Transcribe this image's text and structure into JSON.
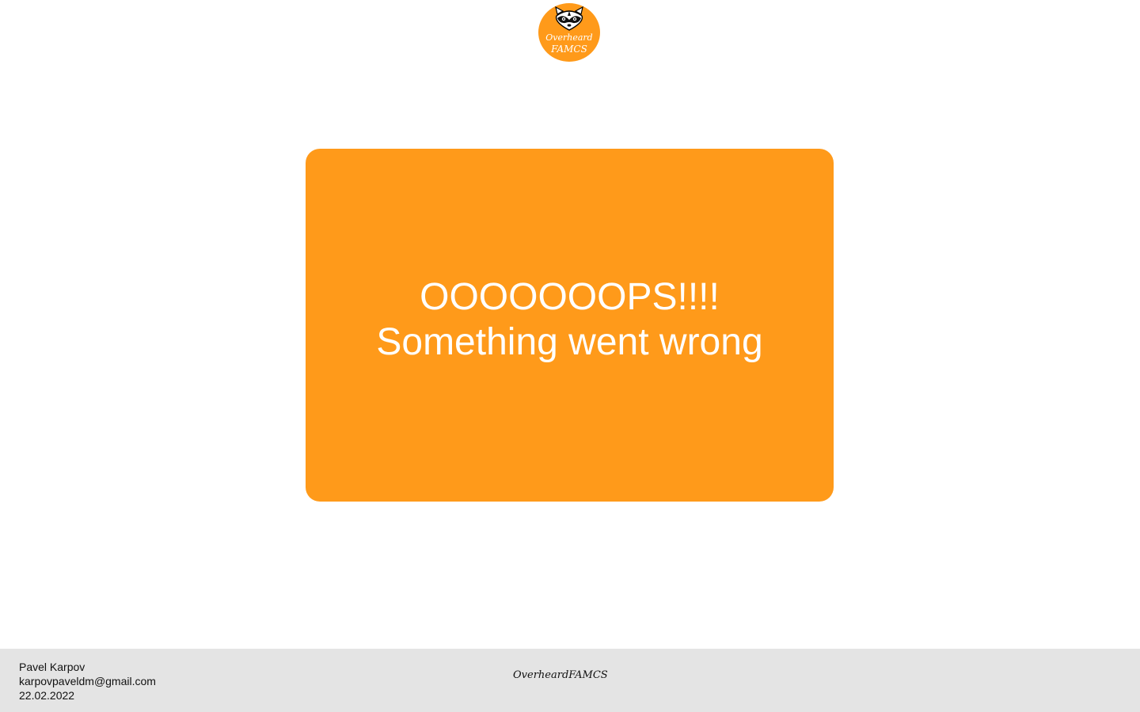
{
  "header": {
    "logo": {
      "line1": "Overheard",
      "line2": "FAMCS",
      "icon": "raccoon-icon",
      "color": "#FF9A1A"
    }
  },
  "error": {
    "title": "OOOOOOOPS!!!!",
    "message": "Something went wrong",
    "background_color": "#FF9A1A",
    "text_color": "#FFFFFF"
  },
  "footer": {
    "author": "Pavel Karpov",
    "email": "karpovpaveldm@gmail.com",
    "date": "22.02.2022",
    "brand_part1": "Overheard",
    "brand_part2": "FAMCS",
    "background_color": "#E4E4E4"
  }
}
